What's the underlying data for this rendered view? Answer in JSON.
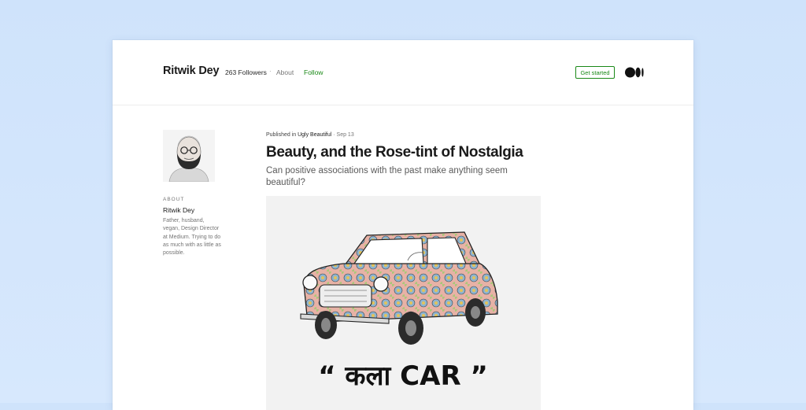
{
  "header": {
    "author_name": "Ritwik Dey",
    "followers": "263 Followers",
    "separator": "·",
    "about_link": "About",
    "follow_link": "Follow",
    "get_started": "Get started",
    "logo_icon": "medium-logo-icon"
  },
  "sidebar": {
    "about_heading": "ABOUT",
    "name": "Ritwik Dey",
    "bio": "Father, husband, vegan, Design Director at Medium. Trying to do as much with as little as possible.",
    "avatar_icon": "author-avatar"
  },
  "article": {
    "published_prefix": "Published in",
    "publication": "Ugly Beautiful",
    "date": "· Sep 13",
    "title": "Beauty, and the Rose-tint of Nostalgia",
    "subtitle": "Can positive associations with the past make anything seem beautiful?",
    "hero_caption": "“ कला CAR ”",
    "hero_icon": "patterned-car-illustration"
  },
  "colors": {
    "accent_green": "#1a8917",
    "background": "#d3e6fc",
    "text_primary": "#1a1a1a",
    "text_muted": "#757575"
  }
}
